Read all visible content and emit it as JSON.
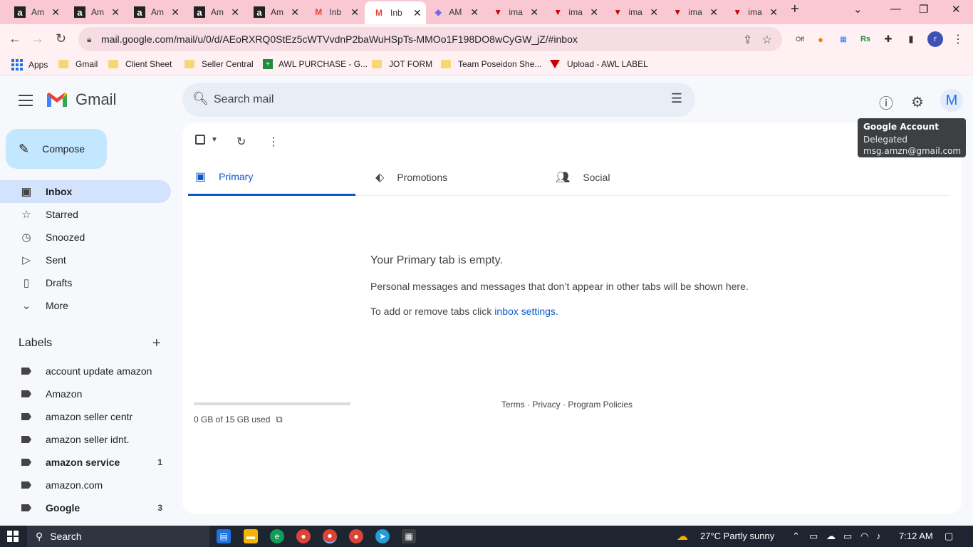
{
  "browser": {
    "tabs": [
      {
        "title": "Am",
        "icon": "amazon-icon"
      },
      {
        "title": "Am",
        "icon": "amazon-icon"
      },
      {
        "title": "Am",
        "icon": "amazon-icon"
      },
      {
        "title": "Am",
        "icon": "amazon-icon"
      },
      {
        "title": "Am",
        "icon": "amazon-icon"
      },
      {
        "title": "Inb",
        "icon": "gmail-icon"
      },
      {
        "title": "Inb",
        "icon": "gmail-icon",
        "active": true
      },
      {
        "title": "AM",
        "icon": "clickup-icon"
      },
      {
        "title": "ima",
        "icon": "awl-icon"
      },
      {
        "title": "ima",
        "icon": "awl-icon"
      },
      {
        "title": "ima",
        "icon": "awl-icon"
      },
      {
        "title": "ima",
        "icon": "awl-icon"
      },
      {
        "title": "ima",
        "icon": "awl-icon"
      }
    ],
    "url": "mail.google.com/mail/u/0/d/AEoRXRQ0StEz5cWTVvdnP2baWuHSpTs-MMOo1F198DO8wCyGW_jZ/#inbox",
    "ext_badge": "Off",
    "profile_initial": "r",
    "bookmarks": [
      "Apps",
      "Gmail",
      "Client Sheet",
      "Seller Central",
      "AWL PURCHASE - G...",
      "JOT FORM",
      "Team Poseidon She...",
      "Upload - AWL LABEL"
    ]
  },
  "gmail": {
    "product_name": "Gmail",
    "search_placeholder": "Search mail",
    "avatar_initial": "M",
    "compose_label": "Compose",
    "nav": [
      "Inbox",
      "Starred",
      "Snoozed",
      "Sent",
      "Drafts",
      "More"
    ],
    "labels_heading": "Labels",
    "labels": [
      {
        "name": "account update amazon",
        "count": ""
      },
      {
        "name": "Amazon",
        "count": ""
      },
      {
        "name": "amazon seller centr",
        "count": ""
      },
      {
        "name": "amazon seller idnt.",
        "count": ""
      },
      {
        "name": "amazon service",
        "count": "1"
      },
      {
        "name": "amazon.com",
        "count": ""
      },
      {
        "name": "Google",
        "count": "3"
      }
    ],
    "tabs": [
      "Primary",
      "Promotions",
      "Social"
    ],
    "empty_title": "Your Primary tab is empty.",
    "empty_desc": "Personal messages and messages that don’t appear in other tabs will be shown here.",
    "empty_hint_prefix": "To add or remove tabs click ",
    "empty_hint_link": "inbox settings",
    "empty_hint_suffix": ".",
    "storage": "0 GB of 15 GB used",
    "footer": "Terms · Privacy · Program Policies",
    "tooltip": {
      "title": "Google Account",
      "line1": "Delegated",
      "line2": "msg.amzn@gmail.com"
    }
  },
  "taskbar": {
    "search_label": "Search",
    "weather": "27°C  Partly sunny",
    "time": "7:12 AM"
  },
  "colors": {
    "accent": "#0b57d0",
    "compose": "#c2e7ff",
    "active_nav": "#d3e3fd",
    "tabstrip": "#f9c8d3"
  }
}
